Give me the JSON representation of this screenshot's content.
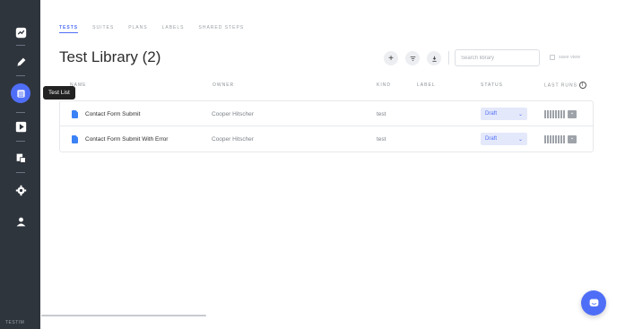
{
  "sidebar": {
    "items": [
      {
        "icon": "dashboard-icon"
      },
      {
        "icon": "pencil-icon"
      },
      {
        "icon": "test-list-icon",
        "active": true
      },
      {
        "icon": "play-icon"
      },
      {
        "icon": "copy-icon"
      },
      {
        "icon": "gear-icon"
      },
      {
        "icon": "user-icon"
      }
    ],
    "brand": "TESTIM",
    "tooltip": "Test List"
  },
  "tabs": [
    {
      "label": "TESTS",
      "active": true
    },
    {
      "label": "SUITES"
    },
    {
      "label": "PLANS"
    },
    {
      "label": "LABELS"
    },
    {
      "label": "SHARED STEPS"
    }
  ],
  "page_title": "Test Library (2)",
  "toolbar": {
    "add_icon": "plus-icon",
    "filter_icon": "filter-icon",
    "download_icon": "download-icon",
    "search_placeholder": "Search library",
    "save_view_label": "save view"
  },
  "table": {
    "columns": [
      "NAME",
      "OWNER",
      "KIND",
      "LABEL",
      "STATUS",
      "LAST RUNS"
    ],
    "rows": [
      {
        "name": "Contact Form Submit",
        "owner": "Cooper Hitscher",
        "kind": "test",
        "label": "",
        "status": "Draft"
      },
      {
        "name": "Contact Form Submit With Error",
        "owner": "Cooper Hitscher",
        "kind": "test",
        "label": "",
        "status": "Draft"
      }
    ]
  },
  "colors": {
    "accent": "#4f6ef7",
    "sidebar": "#2f353d"
  }
}
